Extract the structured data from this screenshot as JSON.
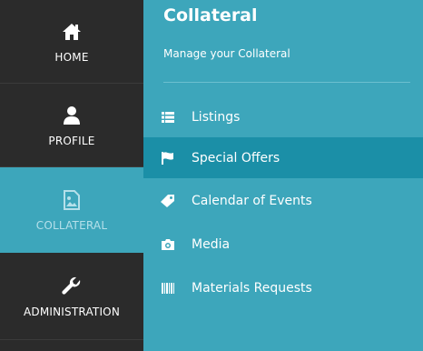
{
  "sidebar": {
    "items": [
      {
        "label": "HOME",
        "icon": "home-icon"
      },
      {
        "label": "PROFILE",
        "icon": "user-icon"
      },
      {
        "label": "COLLATERAL",
        "icon": "image-icon",
        "active": true
      },
      {
        "label": "ADMINISTRATION",
        "icon": "wrench-icon"
      }
    ]
  },
  "panel": {
    "title": "Collateral",
    "subtitle": "Manage your Collateral",
    "menu": [
      {
        "label": "Listings",
        "icon": "list-icon"
      },
      {
        "label": "Special Offers",
        "icon": "flag-icon",
        "active": true
      },
      {
        "label": "Calendar of Events",
        "icon": "tag-icon"
      },
      {
        "label": "Media",
        "icon": "camera-icon"
      },
      {
        "label": "Materials Requests",
        "icon": "barcode-icon"
      }
    ]
  },
  "colors": {
    "rail_bg": "#2b2b2b",
    "accent": "#3da6bb",
    "active_item": "#1b8fa7",
    "text": "#ffffff"
  }
}
